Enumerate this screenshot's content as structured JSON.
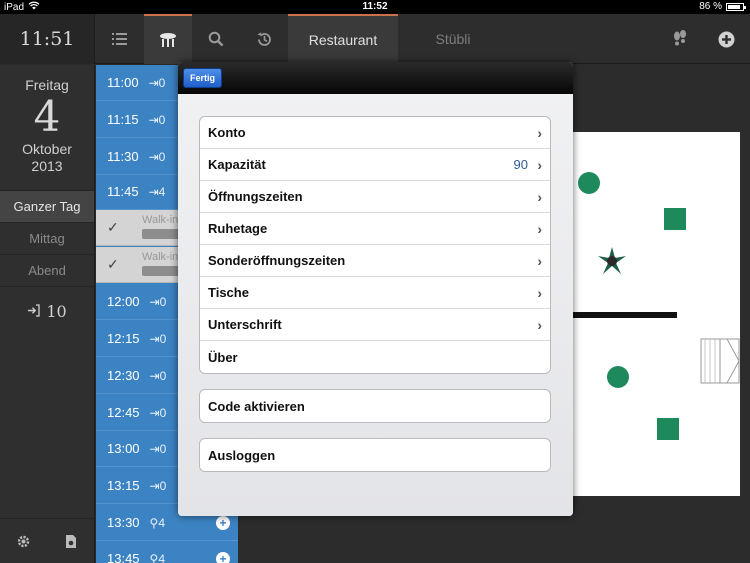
{
  "status": {
    "device": "iPad",
    "time": "11:52",
    "battery": "86 %",
    "battery_level": 0.86
  },
  "nav": {
    "clock": "11:51",
    "tabs": [
      {
        "label": "Restaurant",
        "active": true
      },
      {
        "label": "Stübli",
        "active": false
      }
    ]
  },
  "sidebar": {
    "weekday": "Freitag",
    "day": "4",
    "month": "Oktober",
    "year": "2013",
    "filters": [
      {
        "label": "Ganzer Tag",
        "active": true
      },
      {
        "label": "Mittag"
      },
      {
        "label": "Abend"
      }
    ],
    "count": "10"
  },
  "timeline": {
    "slots_top": [
      {
        "time": "11:00",
        "count": "0"
      },
      {
        "time": "11:15",
        "count": "0"
      },
      {
        "time": "11:30",
        "count": "0"
      },
      {
        "time": "11:45",
        "count": "4"
      }
    ],
    "reservations": [
      {
        "name": "Walk-in"
      },
      {
        "name": "Walk-in"
      }
    ],
    "slots_bottom": [
      {
        "time": "12:00",
        "count": "0"
      },
      {
        "time": "12:15",
        "count": "0"
      },
      {
        "time": "12:30",
        "count": "0"
      },
      {
        "time": "12:45",
        "count": "0"
      },
      {
        "time": "13:00",
        "count": "0"
      },
      {
        "time": "13:15",
        "count": "0"
      },
      {
        "time": "13:30",
        "count": "4"
      },
      {
        "time": "13:45",
        "count": "4"
      }
    ]
  },
  "modal": {
    "done_label": "Fertig",
    "settings": [
      {
        "label": "Konto",
        "value": "",
        "chevron": true
      },
      {
        "label": "Kapazität",
        "value": "90",
        "chevron": true
      },
      {
        "label": "Öffnungszeiten",
        "value": "",
        "chevron": true
      },
      {
        "label": "Ruhetage",
        "value": "",
        "chevron": true
      },
      {
        "label": "Sonderöffnungszeiten",
        "value": "",
        "chevron": true
      },
      {
        "label": "Tische",
        "value": "",
        "chevron": true
      },
      {
        "label": "Unterschrift",
        "value": "",
        "chevron": true
      },
      {
        "label": "Über",
        "value": "",
        "chevron": false
      }
    ],
    "activate_code": "Code aktivieren",
    "logout": "Ausloggen"
  },
  "colors": {
    "accent": "#c8734a",
    "timeline": "#3c83c3",
    "table": "#1e8a5c",
    "done_button": "#2e6fd6"
  }
}
